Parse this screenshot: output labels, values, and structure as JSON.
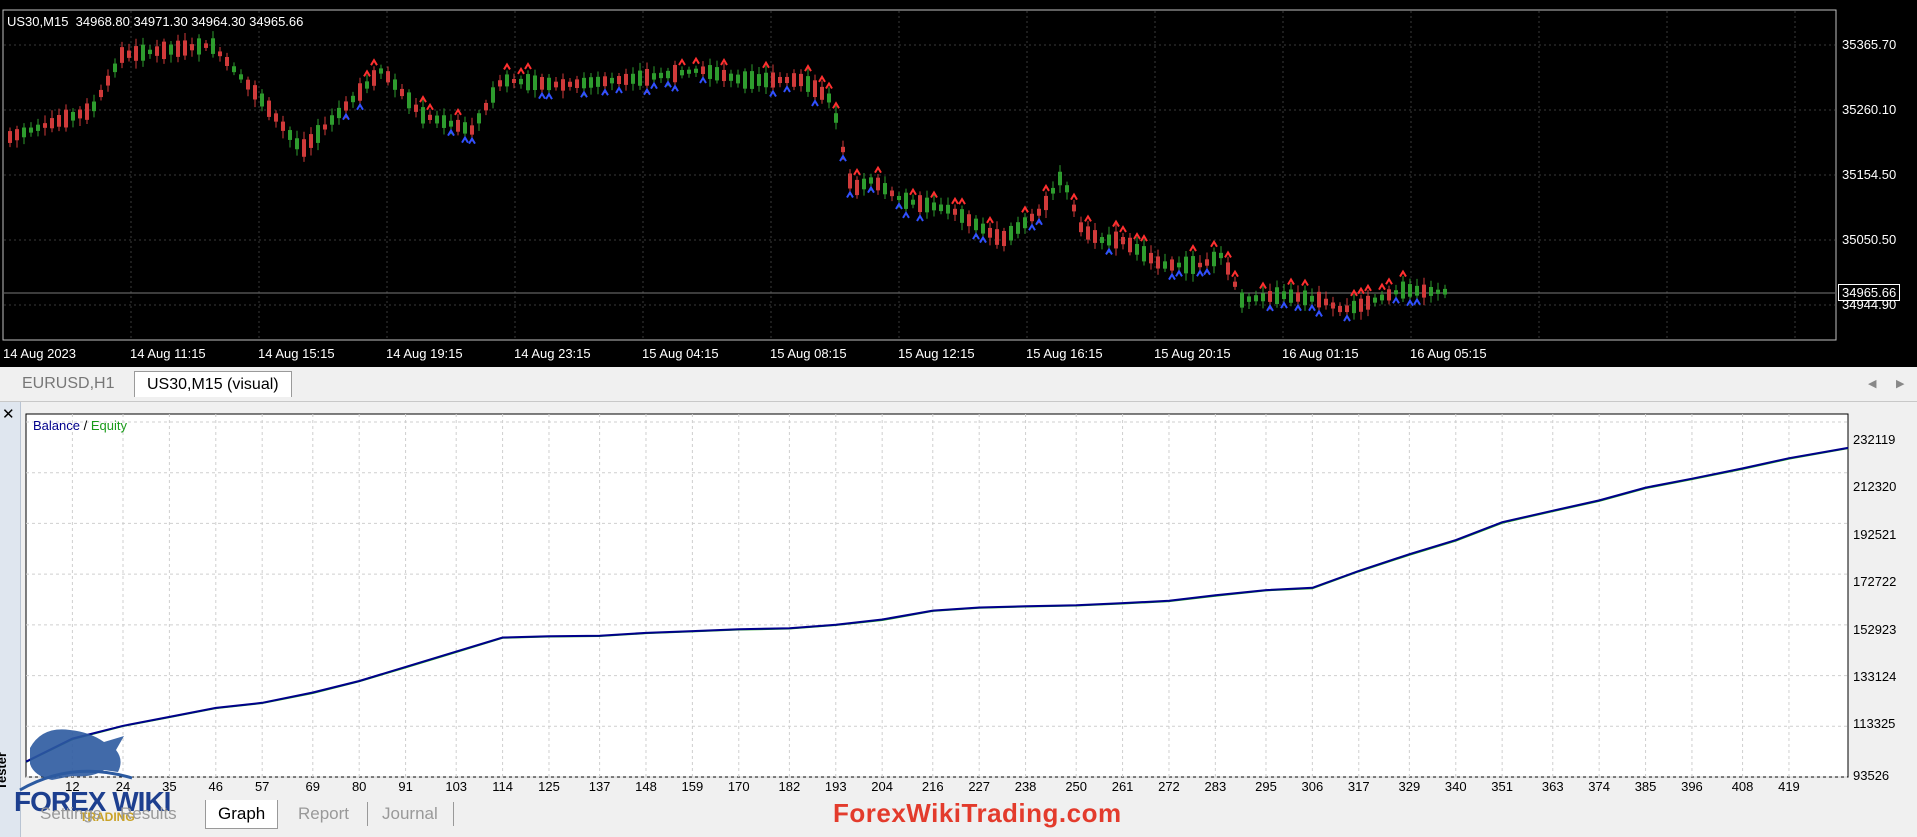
{
  "price_chart": {
    "header": "US30,M15  34968.80 34971.30 34964.30 34965.66",
    "price_scale": [
      "35365.70",
      "35260.10",
      "35154.50",
      "35050.50",
      "34944.90"
    ],
    "current_price": "34965.66",
    "time_axis": [
      "14 Aug 2023",
      "14 Aug 11:15",
      "14 Aug 15:15",
      "14 Aug 19:15",
      "14 Aug 23:15",
      "15 Aug 04:15",
      "15 Aug 08:15",
      "15 Aug 12:15",
      "15 Aug 16:15",
      "15 Aug 20:15",
      "16 Aug 01:15",
      "16 Aug 05:15"
    ],
    "colors": {
      "background": "#000000",
      "bull": "#2e9c2e",
      "bear": "#d03a3a",
      "sell_marker": "#ff3030",
      "buy_marker": "#3050ff",
      "grid": "#3a3a3a"
    }
  },
  "chart_tabs": [
    {
      "label": "EURUSD,H1",
      "active": false
    },
    {
      "label": "US30,M15 (visual)",
      "active": true
    }
  ],
  "tester": {
    "vertical_label": "Tester",
    "close_icon": "close-icon",
    "legend": {
      "balance": "Balance",
      "separator": " / ",
      "equity": "Equity"
    },
    "tabs": [
      {
        "label": "Settings",
        "active": false
      },
      {
        "label": "Results",
        "active": false
      },
      {
        "label": "Graph",
        "active": true
      },
      {
        "label": "Report",
        "active": false
      },
      {
        "label": "Journal",
        "active": false
      }
    ]
  },
  "chart_data": {
    "type": "line",
    "title": "",
    "xlabel": "",
    "ylabel": "",
    "x_ticks": [
      "12",
      "24",
      "35",
      "46",
      "57",
      "69",
      "80",
      "91",
      "103",
      "114",
      "125",
      "137",
      "148",
      "159",
      "170",
      "182",
      "193",
      "204",
      "216",
      "227",
      "238",
      "250",
      "261",
      "272",
      "283",
      "295",
      "306",
      "317",
      "329",
      "340",
      "351",
      "363",
      "374",
      "385",
      "396",
      "408",
      "419"
    ],
    "y_ticks": [
      "232119",
      "212320",
      "192521",
      "172722",
      "152923",
      "133124",
      "113325",
      "93526"
    ],
    "xlim": [
      1,
      433
    ],
    "ylim": [
      93526,
      232119
    ],
    "grid": true,
    "legend_position": "top-left",
    "series": [
      {
        "name": "Balance",
        "color": "#00008b",
        "x": [
          1,
          12,
          24,
          35,
          46,
          57,
          69,
          80,
          91,
          103,
          114,
          125,
          137,
          148,
          159,
          170,
          182,
          193,
          204,
          216,
          227,
          238,
          250,
          261,
          272,
          283,
          295,
          306,
          317,
          329,
          340,
          351,
          363,
          374,
          385,
          396,
          408,
          419,
          433
        ],
        "y": [
          99500,
          108500,
          113500,
          117000,
          120500,
          122500,
          126500,
          131000,
          136500,
          142500,
          148000,
          148500,
          148700,
          149800,
          150500,
          151200,
          151600,
          153000,
          155000,
          158500,
          159700,
          160200,
          160600,
          161400,
          162300,
          164500,
          166500,
          167400,
          174000,
          180500,
          186000,
          193000,
          197500,
          201500,
          206500,
          210000,
          214000,
          218000,
          222000
        ]
      },
      {
        "name": "Equity",
        "color": "#1a9b1a",
        "x": [
          1,
          12,
          24,
          35,
          46,
          57,
          69,
          80,
          91,
          103,
          114,
          125,
          137,
          148,
          159,
          170,
          182,
          193,
          204,
          216,
          227,
          238,
          250,
          261,
          272,
          283,
          295,
          306,
          317,
          329,
          340,
          351,
          363,
          374,
          385,
          396,
          408,
          419,
          433
        ],
        "y": [
          99300,
          108200,
          113300,
          116800,
          120300,
          122300,
          126200,
          130800,
          136200,
          142200,
          147800,
          148300,
          148500,
          149600,
          150300,
          151000,
          151400,
          152800,
          154700,
          158300,
          159500,
          160000,
          160400,
          161200,
          162100,
          164200,
          166300,
          167100,
          173700,
          180200,
          185700,
          192700,
          197200,
          201200,
          206200,
          209700,
          213700,
          217700,
          221800
        ]
      }
    ]
  },
  "watermark": {
    "site": "ForexWikiTrading.com",
    "logo_text": "FOREX WIKI",
    "logo_sub": "TRADING"
  }
}
